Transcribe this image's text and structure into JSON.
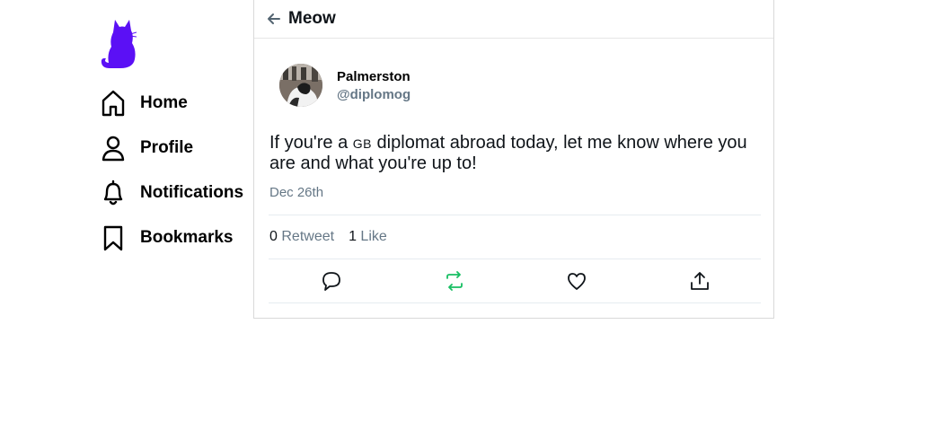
{
  "sidebar": {
    "logo_icon": "cat-logo-icon",
    "brand_color": "#5b10f5",
    "items": [
      {
        "label": "Home",
        "icon": "home-icon"
      },
      {
        "label": "Profile",
        "icon": "user-icon"
      },
      {
        "label": "Notifications",
        "icon": "bell-icon"
      },
      {
        "label": "Bookmarks",
        "icon": "bookmark-icon"
      }
    ]
  },
  "header": {
    "back_icon": "arrow-left-icon",
    "title": "Meow"
  },
  "tweet": {
    "author": {
      "name": "Palmerston",
      "handle": "@diplomog"
    },
    "text_before": "If you're a ",
    "text_smallcaps": "GB",
    "text_after": " diplomat abroad today, let me know where you are and what you're up to!",
    "date": "Dec 26th",
    "stats": {
      "retweets_count": "0",
      "retweets_label": "Retweet",
      "likes_count": "1",
      "likes_label": "Like"
    },
    "actions": [
      {
        "name": "reply",
        "icon": "comment-icon"
      },
      {
        "name": "retweet",
        "icon": "retweet-icon",
        "color": "#17bf63"
      },
      {
        "name": "like",
        "icon": "heart-icon"
      },
      {
        "name": "share",
        "icon": "share-icon"
      }
    ]
  }
}
